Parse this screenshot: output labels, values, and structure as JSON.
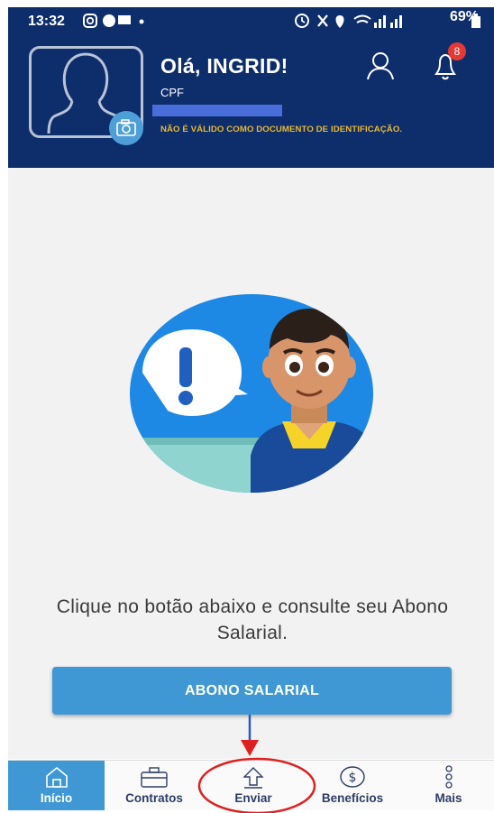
{
  "status_bar": {
    "time": "13:32",
    "battery": "69%"
  },
  "header": {
    "greeting": "Olá, INGRID!",
    "cpf_label": "CPF",
    "disclaimer": "NÃO É VÁLIDO COMO DOCUMENTO DE IDENTIFICAÇÃO.",
    "notification_count": "8",
    "background_color": "#0d2d6b",
    "disclaimer_color": "#e8b933"
  },
  "main": {
    "info_text": "Clique no botão abaixo e consulte seu Abono Salarial.",
    "button_label": "ABONO SALARIAL",
    "button_color": "#3f98d4"
  },
  "bottom_nav": {
    "items": [
      {
        "label": "Início",
        "icon": "home-icon",
        "active": true
      },
      {
        "label": "Contratos",
        "icon": "briefcase-icon",
        "active": false
      },
      {
        "label": "Enviar",
        "icon": "upload-arrow-icon",
        "active": false
      },
      {
        "label": "Benefícios",
        "icon": "dollar-circle-icon",
        "active": false
      },
      {
        "label": "Mais",
        "icon": "more-vertical-icon",
        "active": false
      }
    ]
  }
}
